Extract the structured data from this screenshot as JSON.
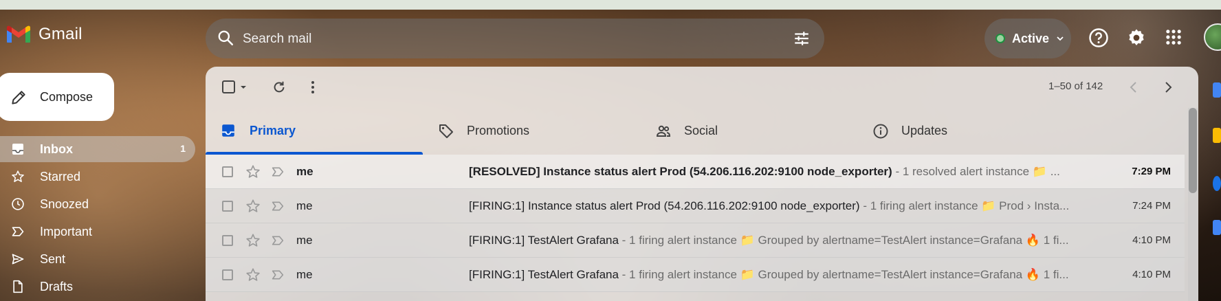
{
  "brand": {
    "name": "Gmail",
    "colors": {
      "red": "#ea4335",
      "blue": "#4285f4",
      "green": "#34a853",
      "yellow": "#fbbc04"
    }
  },
  "search": {
    "placeholder": "Search mail",
    "icon": "search-icon",
    "filter_icon": "tune-icon"
  },
  "status": {
    "label": "Active",
    "indicator_color": "#1e8e3e"
  },
  "header_icons": [
    "help-icon",
    "settings-gear-icon",
    "apps-grid-icon",
    "account-avatar"
  ],
  "compose": {
    "label": "Compose"
  },
  "nav": {
    "items": [
      {
        "label": "Inbox",
        "count": "1",
        "icon": "inbox-icon",
        "active": true
      },
      {
        "label": "Starred",
        "icon": "star-icon"
      },
      {
        "label": "Snoozed",
        "icon": "clock-icon"
      },
      {
        "label": "Important",
        "icon": "important-icon"
      },
      {
        "label": "Sent",
        "icon": "send-icon"
      },
      {
        "label": "Drafts",
        "icon": "draft-icon"
      }
    ]
  },
  "toolbar": {
    "pager_text": "1–50 of 142"
  },
  "tabs": [
    {
      "label": "Primary",
      "icon": "inbox-icon",
      "active": true
    },
    {
      "label": "Promotions",
      "icon": "tag-icon"
    },
    {
      "label": "Social",
      "icon": "people-icon"
    },
    {
      "label": "Updates",
      "icon": "info-icon"
    }
  ],
  "accent_color": "#0b57d0",
  "emails": [
    {
      "sender": "me",
      "subject": "[RESOLVED] Instance status alert Prod (54.206.116.202:9100 node_exporter)",
      "snippet": " - 1 resolved alert instance 📁 ...",
      "time": "7:29 PM",
      "unread": true
    },
    {
      "sender": "me",
      "subject": "[FIRING:1] Instance status alert Prod (54.206.116.202:9100 node_exporter)",
      "snippet": " - 1 firing alert instance 📁 Prod › Insta...",
      "time": "7:24 PM",
      "unread": false
    },
    {
      "sender": "me",
      "subject": "[FIRING:1] TestAlert Grafana",
      "snippet": " - 1 firing alert instance 📁 Grouped by alertname=TestAlert instance=Grafana 🔥 1 fi...",
      "time": "4:10 PM",
      "unread": false
    },
    {
      "sender": "me",
      "subject": "[FIRING:1] TestAlert Grafana",
      "snippet": " - 1 firing alert instance 📁 Grouped by alertname=TestAlert instance=Grafana 🔥 1 fi...",
      "time": "4:10 PM",
      "unread": false
    }
  ]
}
